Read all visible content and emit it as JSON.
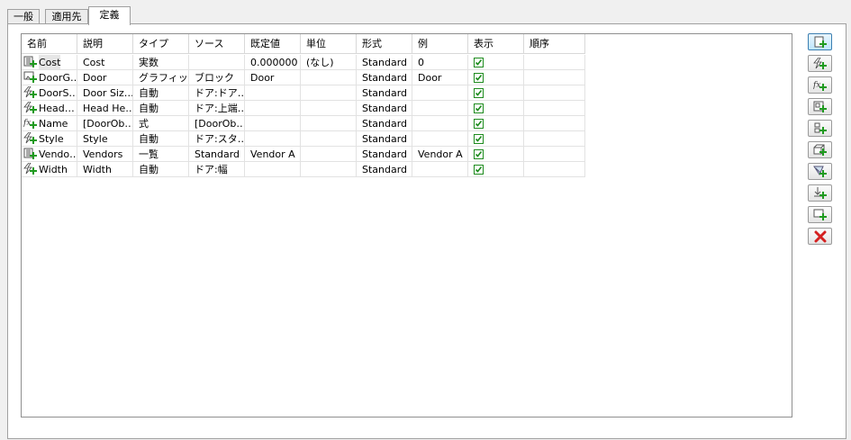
{
  "tabs": [
    {
      "label": "一般"
    },
    {
      "label": "適用先"
    },
    {
      "label": "定義"
    }
  ],
  "columns": [
    "名前",
    "説明",
    "タイプ",
    "ソース",
    "既定値",
    "単位",
    "形式",
    "例",
    "表示",
    "順序"
  ],
  "rows": [
    {
      "icon": "list-property-icon",
      "name": "Cost",
      "desc": "Cost",
      "type": "実数",
      "source": "",
      "default": "0.000000",
      "unit": "(なし)",
      "format": "Standard",
      "example": "0",
      "visible": true
    },
    {
      "icon": "graphic-property-icon",
      "name": "DoorG…",
      "desc": "Door",
      "type": "グラフィッ…",
      "source": "ブロック",
      "default": "Door",
      "unit": "",
      "format": "Standard",
      "example": "Door",
      "visible": true
    },
    {
      "icon": "automatic-property-icon",
      "name": "DoorS…",
      "desc": "Door Siz…",
      "type": "自動",
      "source": "ドア:ドア…",
      "default": "",
      "unit": "",
      "format": "Standard",
      "example": "",
      "visible": true
    },
    {
      "icon": "automatic-property-icon",
      "name": "Head…",
      "desc": "Head He…",
      "type": "自動",
      "source": "ドア:上端…",
      "default": "",
      "unit": "",
      "format": "Standard",
      "example": "",
      "visible": true
    },
    {
      "icon": "formula-property-icon",
      "name": "Name",
      "desc": "[DoorOb…",
      "type": "式",
      "source": "[DoorOb…",
      "default": "",
      "unit": "",
      "format": "Standard",
      "example": "",
      "visible": true
    },
    {
      "icon": "automatic-property-icon",
      "name": "Style",
      "desc": "Style",
      "type": "自動",
      "source": "ドア:スタ…",
      "default": "",
      "unit": "",
      "format": "Standard",
      "example": "",
      "visible": true
    },
    {
      "icon": "list-property-icon",
      "name": "Vendo…",
      "desc": "Vendors",
      "type": "一覧",
      "source": "Standard",
      "default": "Vendor A",
      "unit": "",
      "format": "Standard",
      "example": "Vendor A",
      "visible": true
    },
    {
      "icon": "automatic-property-icon",
      "name": "Width",
      "desc": "Width",
      "type": "自動",
      "source": "ドア:幅",
      "default": "",
      "unit": "",
      "format": "Standard",
      "example": "",
      "visible": true
    }
  ],
  "side_buttons": [
    {
      "name": "add-manual-property-button",
      "icon": "manual-property-icon"
    },
    {
      "name": "add-automatic-property-button",
      "icon": "automatic-property-icon"
    },
    {
      "name": "add-formula-property-button",
      "icon": "formula-property-icon"
    },
    {
      "name": "add-anchor-property-button",
      "icon": "anchor-property-icon"
    },
    {
      "name": "add-location-property-button",
      "icon": "location-property-icon"
    },
    {
      "name": "add-classification-property-button",
      "icon": "classification-property-icon"
    },
    {
      "name": "add-material-property-button",
      "icon": "material-property-icon"
    },
    {
      "name": "add-graphic-property-button",
      "icon": "graphic-block-property-icon"
    },
    {
      "name": "add-graphic-image-property-button",
      "icon": "graphic-image-property-icon"
    },
    {
      "name": "delete-property-button",
      "icon": "delete-icon"
    }
  ]
}
